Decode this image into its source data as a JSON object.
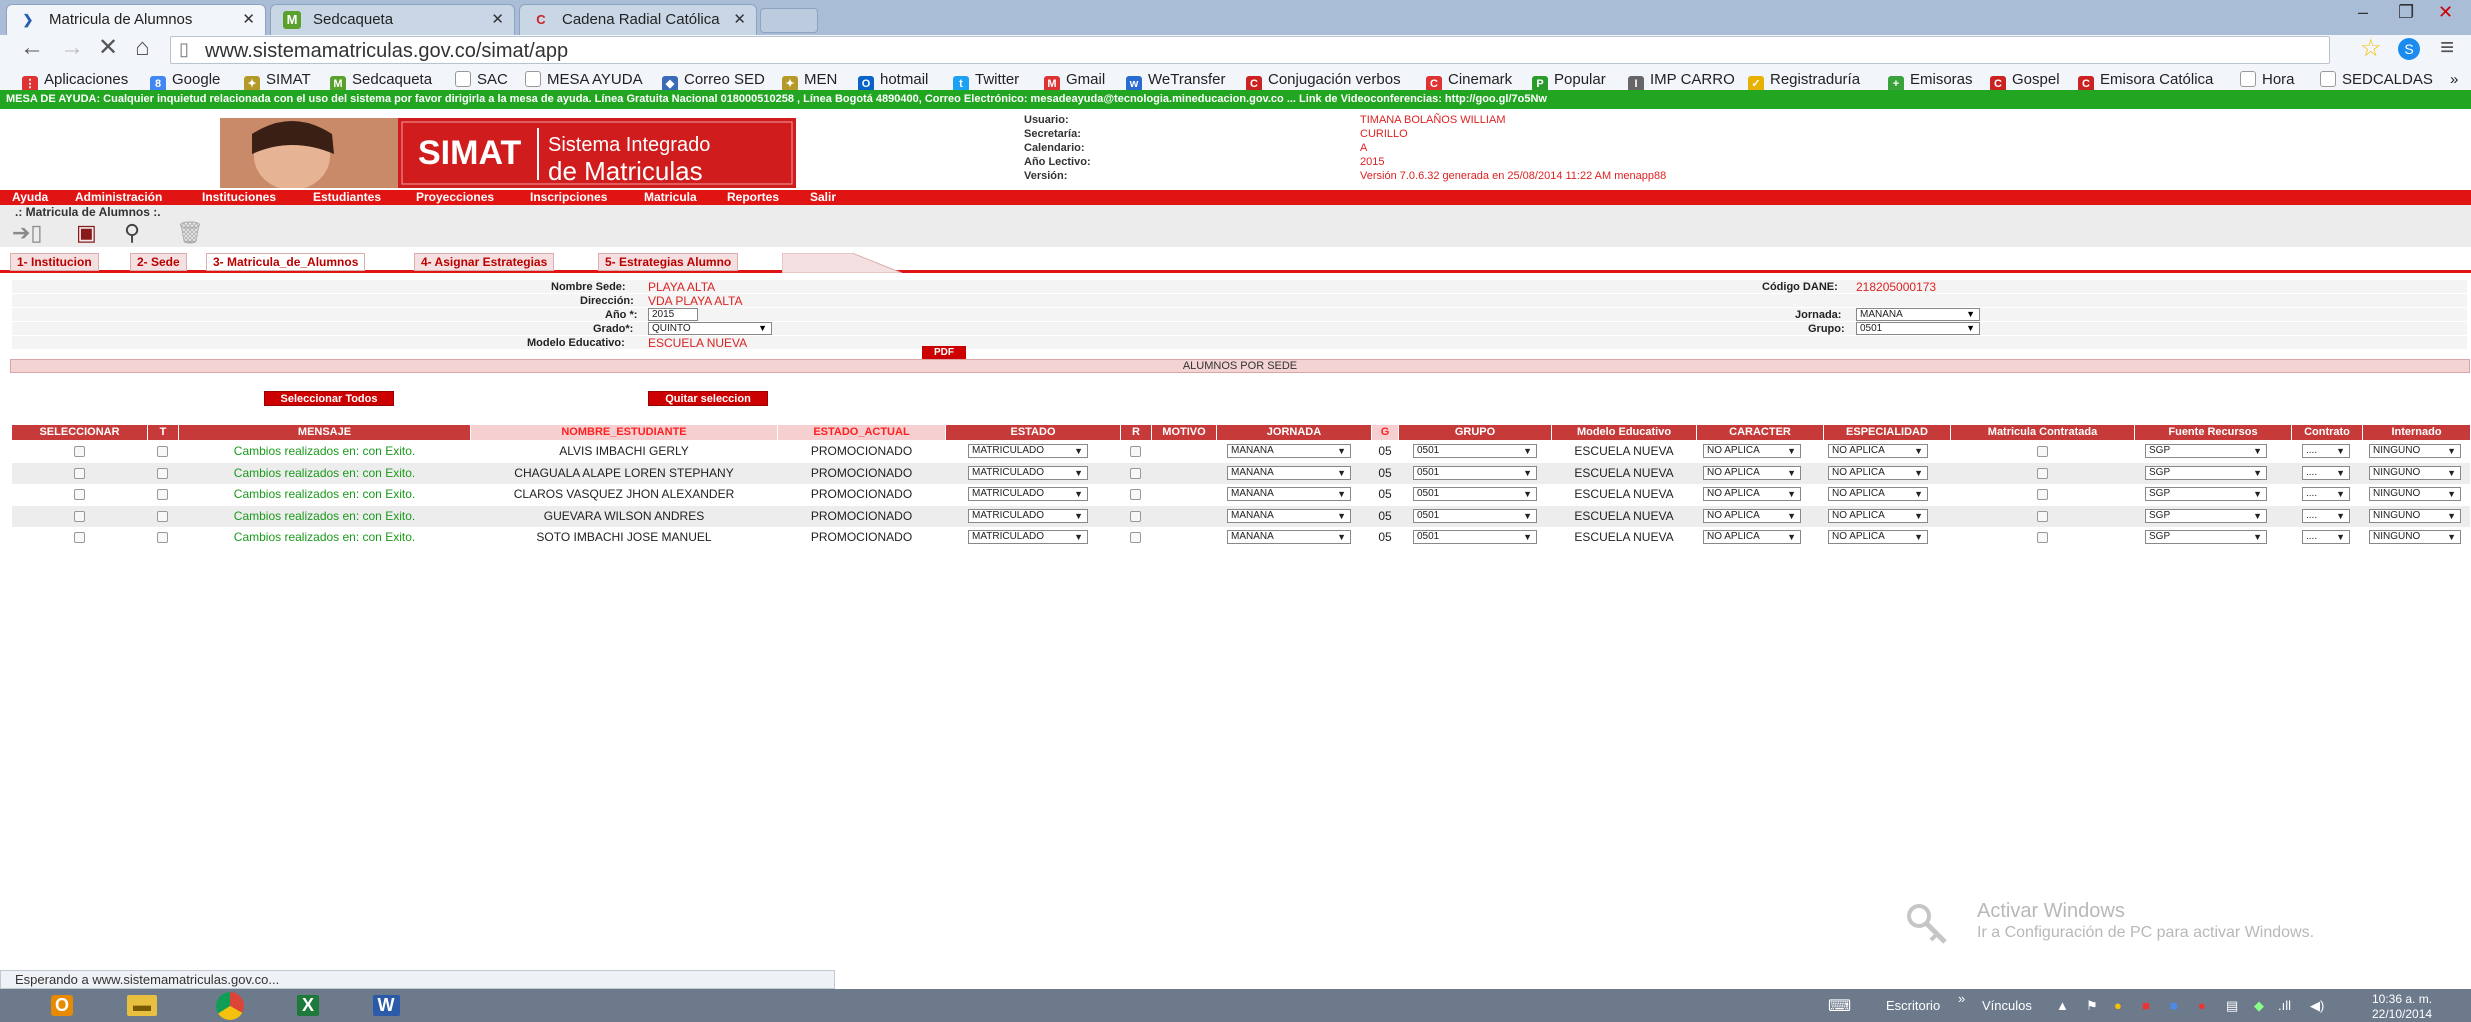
{
  "browser": {
    "tabs": [
      {
        "title": "Matricula de Alumnos",
        "active": true
      },
      {
        "title": "Sedcaqueta",
        "active": false
      },
      {
        "title": "Cadena Radial Católica",
        "active": false
      }
    ],
    "url": "www.sistemamatriculas.gov.co/simat/app",
    "bookmarks": [
      "Aplicaciones",
      "Google",
      "SIMAT",
      "Sedcaqueta",
      "SAC",
      "MESA AYUDA",
      "Correo SED",
      "MEN",
      "hotmail",
      "Twitter",
      "Gmail",
      "WeTransfer",
      "Conjugación verbos",
      "Cinemark",
      "Popular",
      "IMP CARRO",
      "Registraduría",
      "Emisoras",
      "Gospel",
      "Emisora Católica",
      "Hora",
      "SEDCALDAS"
    ],
    "status": "Esperando a www.sistemamatriculas.gov.co..."
  },
  "help_bar": "MESA DE AYUDA: Cualquier inquietud relacionada con el uso del sistema por favor dirigirla a la mesa de ayuda. Línea Gratuita Nacional 018000510258 , Línea Bogotá 4890400, Correo Electrónico: mesadeayuda@tecnologia.mineducacion.gov.co ... Link de Videoconferencias: http://goo.gl/7o5Nw",
  "banner": {
    "logo": "SIMAT",
    "line1": "Sistema Integrado",
    "line2": "de Matriculas"
  },
  "user_info": {
    "usuario_label": "Usuario:",
    "usuario": "TIMANA BOLAÑOS WILLIAM",
    "secretaria_label": "Secretaría:",
    "secretaria": "CURILLO",
    "calendario_label": "Calendario:",
    "calendario": "A",
    "anio_label": "Año Lectivo:",
    "anio": "2015",
    "version_label": "Versión:",
    "version": "Versión 7.0.6.32 generada en 25/08/2014 11:22 AM menapp88"
  },
  "menu": [
    "Ayuda",
    "Administración",
    "Instituciones",
    "Estudiantes",
    "Proyecciones",
    "Inscripciones",
    "Matricula",
    "Reportes",
    "Salir"
  ],
  "breadcrumb": ".: Matricula de Alumnos :.",
  "app_tabs": [
    "1- Institucion",
    "2- Sede",
    "3- Matricula_de_Alumnos",
    "4- Asignar Estrategias",
    "5- Estrategias Alumno"
  ],
  "form": {
    "nombre_sede_label": "Nombre Sede:",
    "nombre_sede": "PLAYA ALTA",
    "direccion_label": "Dirección:",
    "direccion": "VDA PLAYA ALTA",
    "anio_label": "Año *:",
    "anio": "2015",
    "grado_label": "Grado*:",
    "grado": "QUINTO",
    "modelo_label": "Modelo Educativo:",
    "modelo": "ESCUELA NUEVA",
    "dane_label": "Código DANE:",
    "dane": "218205000173",
    "jornada_label": "Jornada:",
    "jornada": "MAÑANA",
    "grupo_label": "Grupo:",
    "grupo": "0501",
    "pdf": "PDF"
  },
  "alumnos_title": "ALUMNOS POR SEDE",
  "buttons": {
    "select_all": "Seleccionar Todos",
    "remove_selection": "Quitar seleccion"
  },
  "table": {
    "headers": [
      "SELECCIONAR",
      "T",
      "MENSAJE",
      "NOMBRE_ESTUDIANTE",
      "ESTADO_ACTUAL",
      "ESTADO",
      "R",
      "MOTIVO",
      "JORNADA",
      "G",
      "GRUPO",
      "Modelo Educativo",
      "CARACTER",
      "ESPECIALIDAD",
      "Matricula Contratada",
      "Fuente Recursos",
      "Contrato",
      "Internado"
    ],
    "rows": [
      {
        "mensaje": "Cambios realizados en: con Exito.",
        "nombre": "ALVIS IMBACHI GERLY",
        "estado_actual": "PROMOCIONADO",
        "estado": "MATRICULADO",
        "jornada": "MAÑANA",
        "g": "05",
        "grupo": "0501",
        "modelo": "ESCUELA NUEVA",
        "caracter": "NO APLICA",
        "especialidad": "NO APLICA",
        "fuente": "SGP",
        "contrato": "....",
        "internado": "NINGUNO"
      },
      {
        "mensaje": "Cambios realizados en: con Exito.",
        "nombre": "CHAGUALA ALAPE LOREN STEPHANY",
        "estado_actual": "PROMOCIONADO",
        "estado": "MATRICULADO",
        "jornada": "MAÑANA",
        "g": "05",
        "grupo": "0501",
        "modelo": "ESCUELA NUEVA",
        "caracter": "NO APLICA",
        "especialidad": "NO APLICA",
        "fuente": "SGP",
        "contrato": "....",
        "internado": "NINGUNO"
      },
      {
        "mensaje": "Cambios realizados en: con Exito.",
        "nombre": "CLAROS VASQUEZ JHON ALEXANDER",
        "estado_actual": "PROMOCIONADO",
        "estado": "MATRICULADO",
        "jornada": "MAÑANA",
        "g": "05",
        "grupo": "0501",
        "modelo": "ESCUELA NUEVA",
        "caracter": "NO APLICA",
        "especialidad": "NO APLICA",
        "fuente": "SGP",
        "contrato": "....",
        "internado": "NINGUNO"
      },
      {
        "mensaje": "Cambios realizados en: con Exito.",
        "nombre": "GUEVARA WILSON ANDRES",
        "estado_actual": "PROMOCIONADO",
        "estado": "MATRICULADO",
        "jornada": "MAÑANA",
        "g": "05",
        "grupo": "0501",
        "modelo": "ESCUELA NUEVA",
        "caracter": "NO APLICA",
        "especialidad": "NO APLICA",
        "fuente": "SGP",
        "contrato": "....",
        "internado": "NINGUNO"
      },
      {
        "mensaje": "Cambios realizados en: con Exito.",
        "nombre": "SOTO IMBACHI JOSE MANUEL",
        "estado_actual": "PROMOCIONADO",
        "estado": "MATRICULADO",
        "jornada": "MAÑANA",
        "g": "05",
        "grupo": "0501",
        "modelo": "ESCUELA NUEVA",
        "caracter": "NO APLICA",
        "especialidad": "NO APLICA",
        "fuente": "SGP",
        "contrato": "....",
        "internado": "NINGUNO"
      }
    ]
  },
  "watermark": {
    "title": "Activar Windows",
    "subtitle": "Ir a Configuración de PC para activar Windows."
  },
  "taskbar": {
    "escritorio": "Escritorio",
    "vinculos": "Vínculos",
    "time": "10:36 a. m.",
    "date": "22/10/2014"
  }
}
